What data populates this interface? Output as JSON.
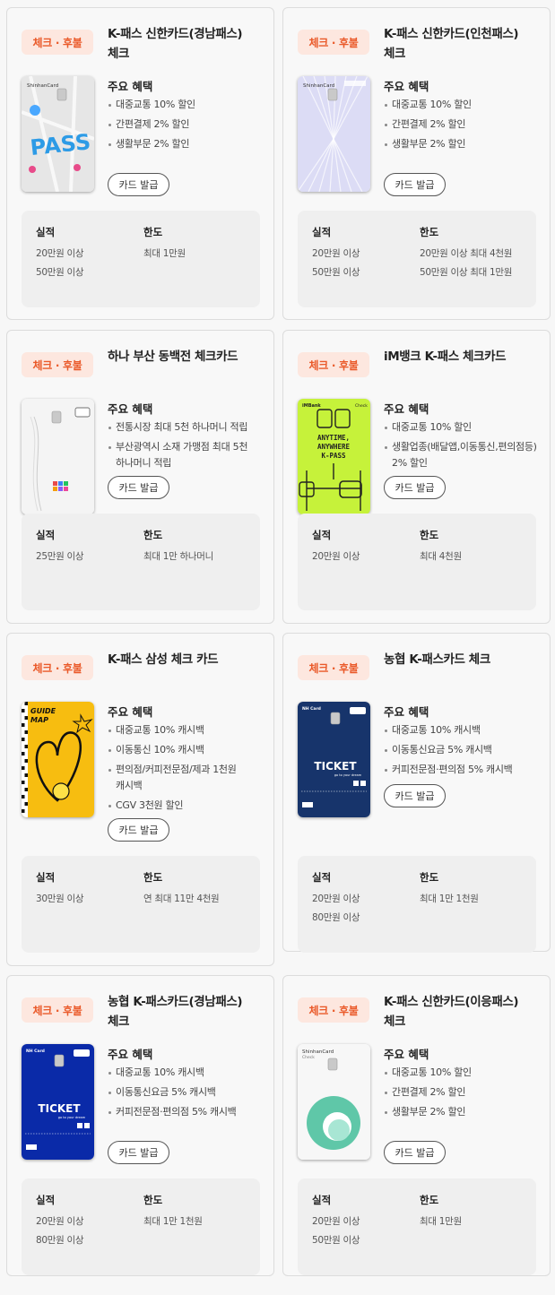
{
  "cards": [
    {
      "badge": "체크 · 후불",
      "title": "K-패스 신한카드(경남패스) 체크",
      "benefits_head": "주요 혜택",
      "benefits": [
        "대중교통 10% 할인",
        "간편결제 2% 할인",
        "생활부문 2% 할인"
      ],
      "button": "카드 발급",
      "stat_label_1": "실적",
      "stat_label_2": "한도",
      "perf": [
        "20만원 이상",
        "50만원 이상"
      ],
      "limit": [
        "최대 1만원"
      ],
      "image": {
        "issuer": "ShinhanCard",
        "sub": "Check",
        "text": "PASS",
        "bg": "#e6e6e6",
        "accent": "#2d9be6"
      }
    },
    {
      "badge": "체크 · 후불",
      "title": "K-패스 신한카드(인천패스) 체크",
      "benefits_head": "주요 혜택",
      "benefits": [
        "대중교통 10% 할인",
        "간편결제 2% 할인",
        "생활부문 2% 할인"
      ],
      "button": "카드 발급",
      "stat_label_1": "실적",
      "stat_label_2": "한도",
      "perf": [
        "20만원 이상",
        "50만원 이상"
      ],
      "limit": [
        "20만원 이상 최대 4천원",
        "50만원 이상 최대 1만원"
      ],
      "image": {
        "issuer": "ShinhanCard",
        "sub": "Check",
        "text": "",
        "bg": "#dcdcf5",
        "accent": "#9fb5ef"
      }
    },
    {
      "badge": "체크 · 후불",
      "title": "하나 부산 동백전 체크카드",
      "benefits_head": "주요 혜택",
      "benefits": [
        "전통시장 최대 5천 하나머니 적립",
        "부산광역시 소재 가맹점 최대 5천 하나머니 적립"
      ],
      "button": "카드 발급",
      "stat_label_1": "실적",
      "stat_label_2": "한도",
      "perf": [
        "25만원 이상"
      ],
      "limit": [
        "최대 1만 하나머니"
      ],
      "image": {
        "issuer": "",
        "sub": "",
        "text": "",
        "bg": "#f4f4f4",
        "accent": "#d0d0d0"
      }
    },
    {
      "badge": "체크 · 후불",
      "title": "iM뱅크 K-패스 체크카드",
      "benefits_head": "주요 혜택",
      "benefits": [
        "대중교통 10% 할인",
        "생활업종(배달앱,이동통신,편의점등) 2% 할인"
      ],
      "button": "카드 발급",
      "stat_label_1": "실적",
      "stat_label_2": "한도",
      "perf": [
        "20만원 이상"
      ],
      "limit": [
        "최대 4천원"
      ],
      "image": {
        "issuer": "iMBank",
        "sub": "Check",
        "text": "ANYTIME, ANYWHERE K-PASS",
        "bg": "#c6f23a",
        "accent": "#222222"
      }
    },
    {
      "badge": "체크 · 후불",
      "title": "K-패스 삼성 체크 카드",
      "benefits_head": "주요 혜택",
      "benefits": [
        "대중교통 10% 캐시백",
        "이동통신 10% 캐시백",
        "편의점/커피전문점/제과 1천원 캐시백",
        "CGV 3천원 할인"
      ],
      "button": "카드 발급",
      "stat_label_1": "실적",
      "stat_label_2": "한도",
      "perf": [
        "30만원 이상"
      ],
      "limit": [
        "연 최대 11만 4천원"
      ],
      "image": {
        "issuer": "",
        "sub": "",
        "text": "GUIDE MAP",
        "bg": "#f7bd10",
        "accent": "#1c1c1c"
      }
    },
    {
      "badge": "체크 · 후불",
      "title": "농협 K-패스카드 체크",
      "benefits_head": "주요 혜택",
      "benefits": [
        "대중교통 10% 캐시백",
        "이동통신요금 5% 캐시백",
        "커피전문점·편의점 5% 캐시백"
      ],
      "button": "카드 발급",
      "stat_label_1": "실적",
      "stat_label_2": "한도",
      "perf": [
        "20만원 이상",
        "80만원 이상"
      ],
      "limit": [
        "최대 1만 1천원"
      ],
      "image": {
        "issuer": "NH Card",
        "sub": "",
        "text": "TICKET",
        "bg": "#17346b",
        "accent": "#ffffff"
      }
    },
    {
      "badge": "체크 · 후불",
      "title": "농협 K-패스카드(경남패스) 체크",
      "benefits_head": "주요 혜택",
      "benefits": [
        "대중교통 10% 캐시백",
        "이동통신요금 5% 캐시백",
        "커피전문점·편의점 5% 캐시백"
      ],
      "button": "카드 발급",
      "stat_label_1": "실적",
      "stat_label_2": "한도",
      "perf": [
        "20만원 이상",
        "80만원 이상"
      ],
      "limit": [
        "최대 1만 1천원"
      ],
      "image": {
        "issuer": "NH Card",
        "sub": "",
        "text": "TICKET",
        "bg": "#0a2aa8",
        "accent": "#ffffff"
      }
    },
    {
      "badge": "체크 · 후불",
      "title": "K-패스 신한카드(이응패스) 체크",
      "benefits_head": "주요 혜택",
      "benefits": [
        "대중교통 10% 할인",
        "간편결제 2% 할인",
        "생활부문 2% 할인"
      ],
      "button": "카드 발급",
      "stat_label_1": "실적",
      "stat_label_2": "한도",
      "perf": [
        "20만원 이상",
        "50만원 이상"
      ],
      "limit": [
        "최대 1만원"
      ],
      "image": {
        "issuer": "ShinhanCard",
        "sub": "Check",
        "text": "",
        "bg": "#f7f7f7",
        "accent": "#5fc7a8"
      }
    }
  ]
}
